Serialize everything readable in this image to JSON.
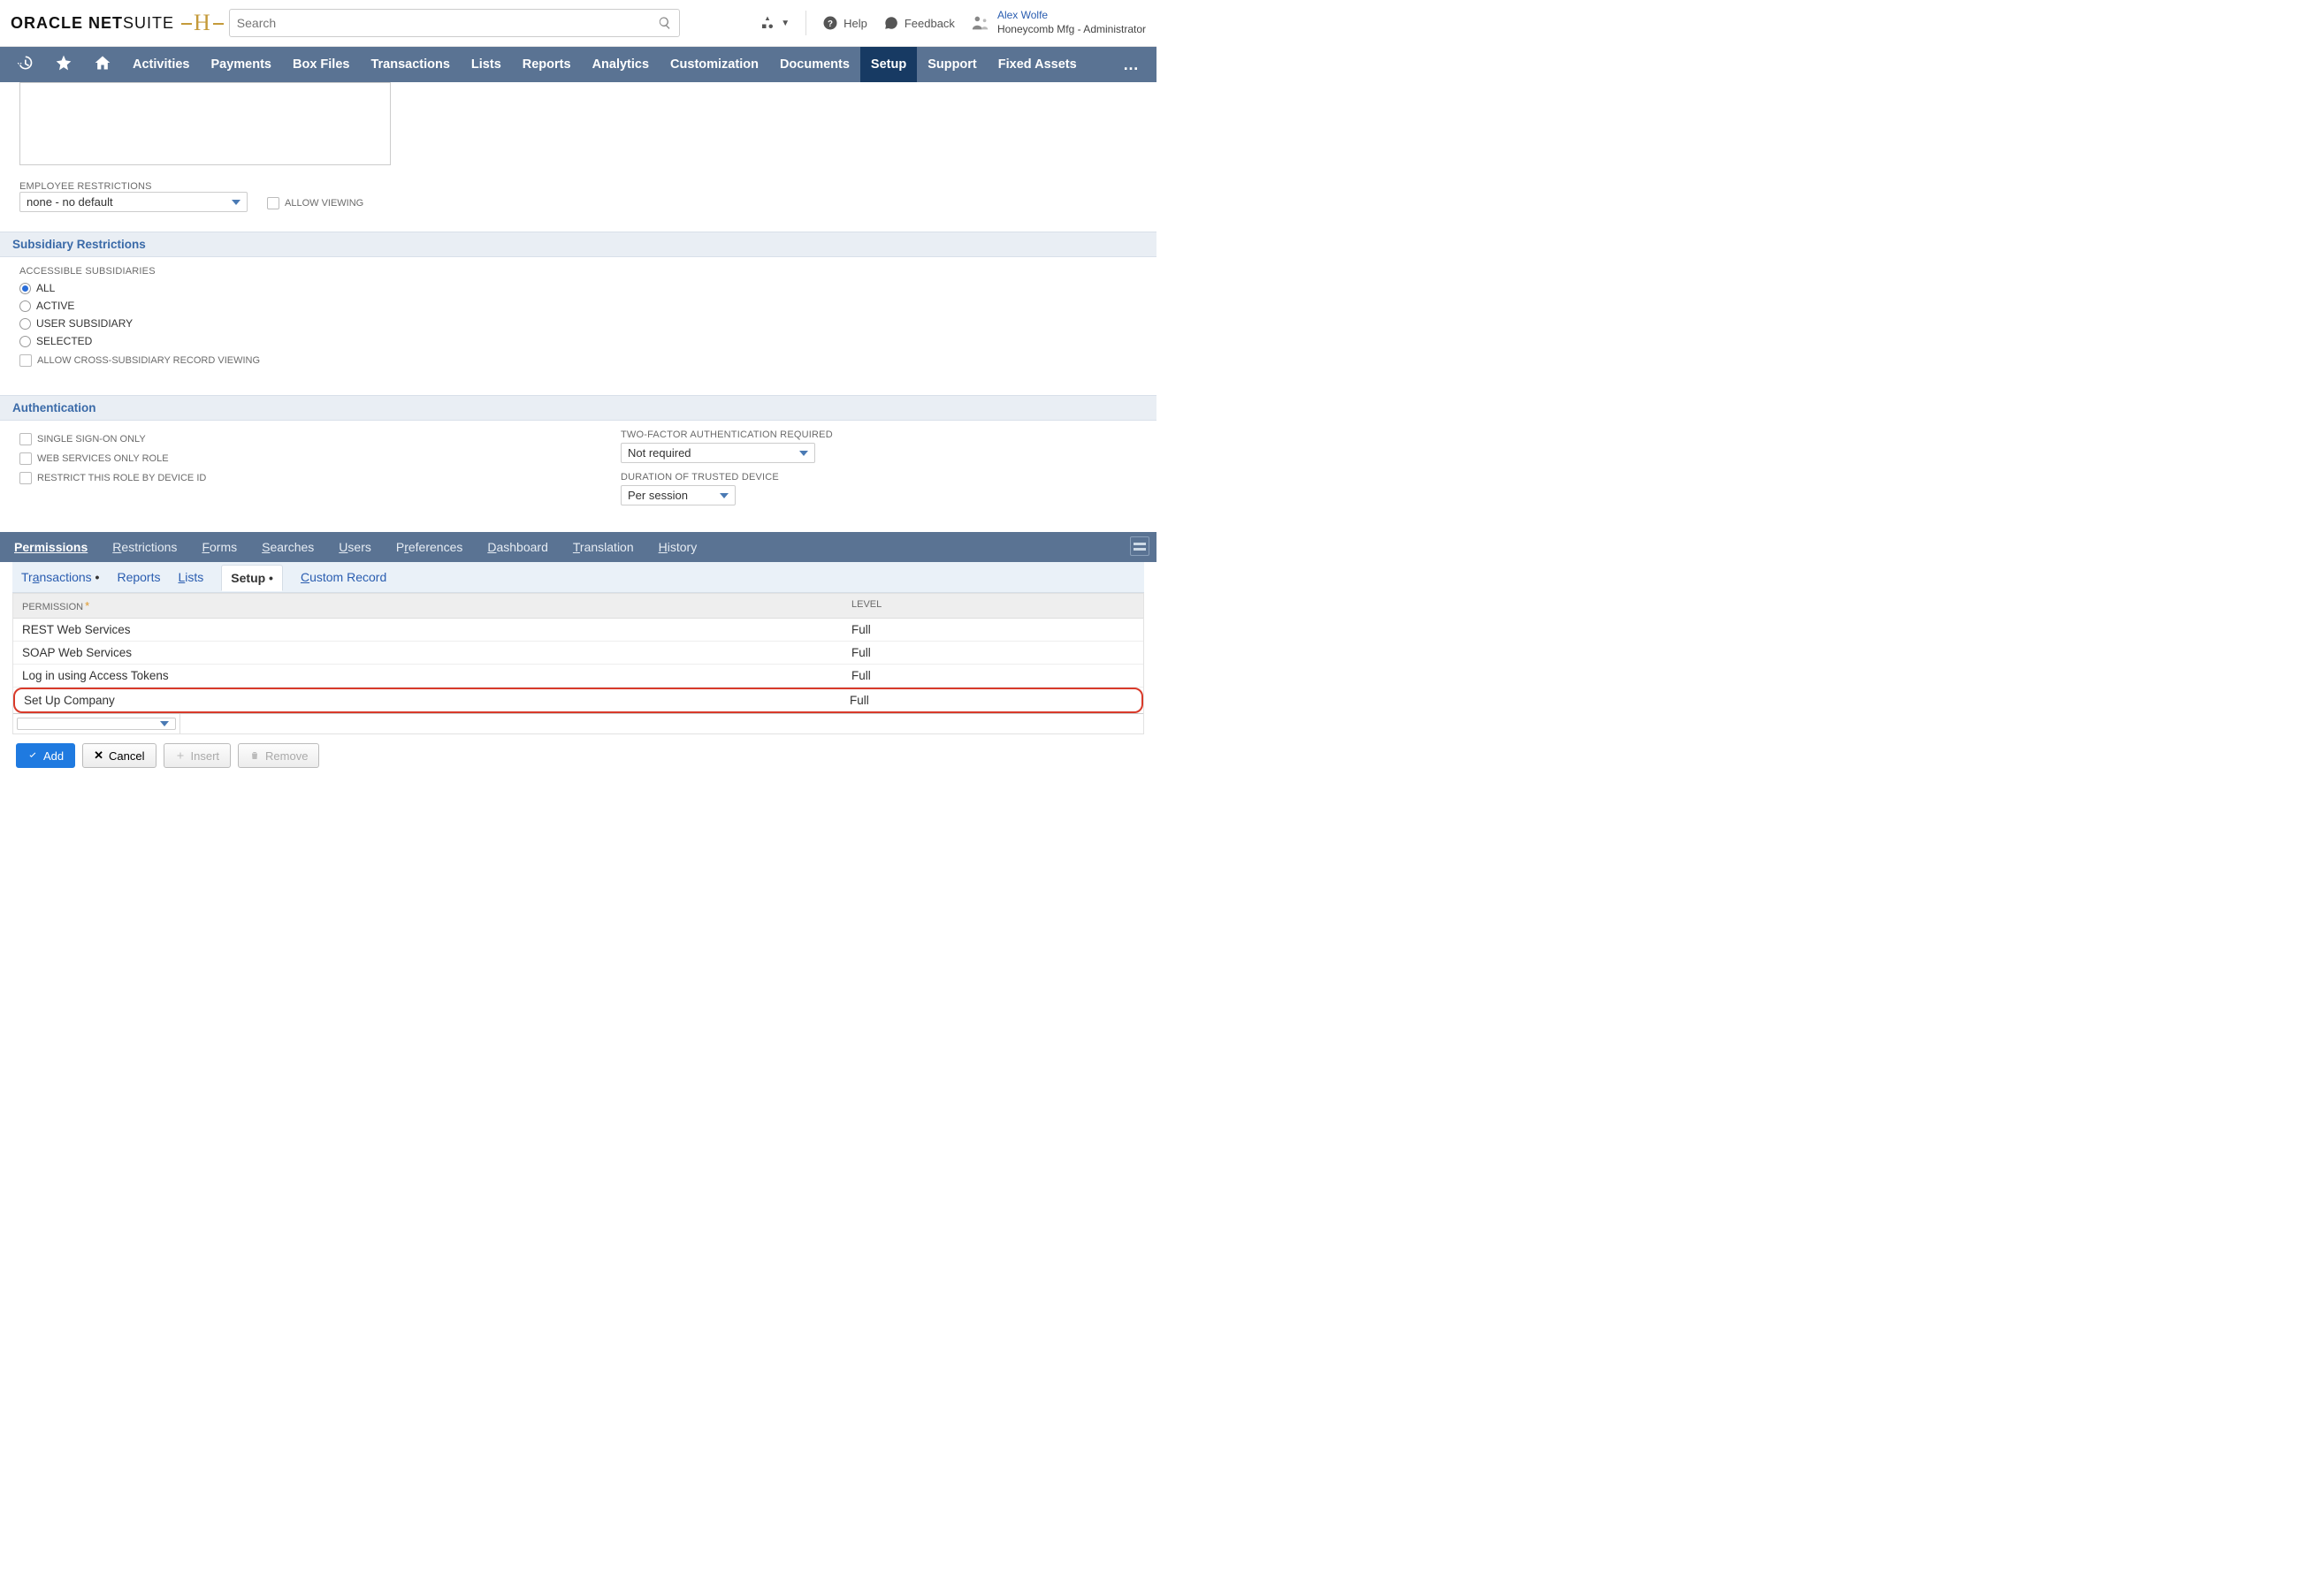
{
  "brand": {
    "oracle": "ORACLE",
    "netsuite_a": "NET",
    "netsuite_b": "SUITE",
    "h": "H"
  },
  "search": {
    "placeholder": "Search"
  },
  "top": {
    "help": "Help",
    "feedback": "Feedback"
  },
  "user": {
    "name": "Alex Wolfe",
    "role": "Honeycomb Mfg - Administrator"
  },
  "nav": {
    "items": [
      "Activities",
      "Payments",
      "Box Files",
      "Transactions",
      "Lists",
      "Reports",
      "Analytics",
      "Customization",
      "Documents",
      "Setup",
      "Support",
      "Fixed Assets"
    ],
    "active": "Setup"
  },
  "emp": {
    "label": "EMPLOYEE RESTRICTIONS",
    "value": "none - no default",
    "allow": "ALLOW VIEWING"
  },
  "subs": {
    "header": "Subsidiary Restrictions",
    "label": "ACCESSIBLE SUBSIDIARIES",
    "opts": [
      "ALL",
      "ACTIVE",
      "USER SUBSIDIARY",
      "SELECTED"
    ],
    "selected": "ALL",
    "cross": "ALLOW CROSS-SUBSIDIARY RECORD VIEWING"
  },
  "auth": {
    "header": "Authentication",
    "sso": "SINGLE SIGN-ON ONLY",
    "ws": "WEB SERVICES ONLY ROLE",
    "device": "RESTRICT THIS ROLE BY DEVICE ID",
    "tfa_label": "TWO-FACTOR AUTHENTICATION REQUIRED",
    "tfa_value": "Not required",
    "dur_label": "DURATION OF TRUSTED DEVICE",
    "dur_value": "Per session"
  },
  "tabs": {
    "active": "Permissions",
    "items": [
      {
        "u": "P",
        "rest": "ermissions"
      },
      {
        "u": "R",
        "rest": "estrictions"
      },
      {
        "u": "F",
        "rest": "orms"
      },
      {
        "u": "S",
        "rest": "earches"
      },
      {
        "u": "U",
        "rest": "sers"
      },
      {
        "pre": "P",
        "u": "r",
        "rest": "eferences"
      },
      {
        "u": "D",
        "rest": "ashboard"
      },
      {
        "u": "T",
        "rest": "ranslation"
      },
      {
        "u": "H",
        "rest": "istory"
      }
    ]
  },
  "subtabs": {
    "active": "Setup",
    "items": [
      {
        "pre": "Tr",
        "u": "a",
        "rest": "nsactions",
        "dot": true
      },
      {
        "pre": "",
        "u": "",
        "rest": "Reports"
      },
      {
        "pre": "",
        "u": "L",
        "rest": "ists"
      },
      {
        "pre": "",
        "u": "",
        "rest": "Setup",
        "dot": true
      },
      {
        "pre": "",
        "u": "C",
        "rest": "ustom Record"
      }
    ]
  },
  "grid": {
    "col_perm": "PERMISSION",
    "col_lvl": "LEVEL",
    "rows": [
      {
        "perm": "REST Web Services",
        "lvl": "Full"
      },
      {
        "perm": "SOAP Web Services",
        "lvl": "Full"
      },
      {
        "perm": "Log in using Access Tokens",
        "lvl": "Full"
      },
      {
        "perm": "Set Up Company",
        "lvl": "Full",
        "hl": true
      }
    ]
  },
  "btns": {
    "add": "Add",
    "cancel": "Cancel",
    "insert": "Insert",
    "remove": "Remove"
  }
}
